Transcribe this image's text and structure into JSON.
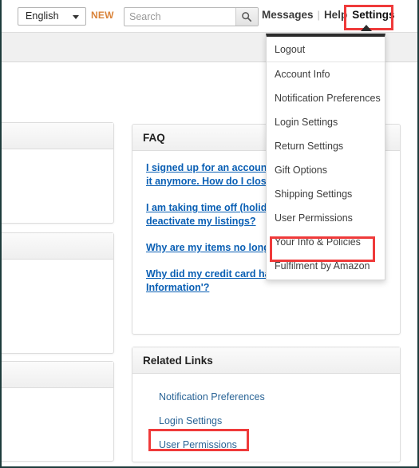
{
  "topbar": {
    "language": {
      "selected": "English",
      "caret_icon": "chevron-down-icon"
    },
    "new_badge": "NEW",
    "search": {
      "value": "",
      "placeholder": "Search",
      "button_icon": "search-icon"
    },
    "nav": {
      "messages": "Messages",
      "separator": "|",
      "help": "Help",
      "settings": "Settings"
    }
  },
  "settings_menu": {
    "items": [
      {
        "label": "Logout"
      },
      {
        "label": "Account Info"
      },
      {
        "label": "Notification Preferences"
      },
      {
        "label": "Login Settings"
      },
      {
        "label": "Return Settings"
      },
      {
        "label": "Gift Options"
      },
      {
        "label": "Shipping Settings"
      },
      {
        "label": "User Permissions"
      },
      {
        "label": "Your Info & Policies"
      },
      {
        "label": "Fulfilment by Amazon"
      }
    ]
  },
  "faq": {
    "title": "FAQ",
    "links": [
      {
        "line1": "I signed up for an account ",
        "line2": "it anymore. How do I close"
      },
      {
        "line1": "I am taking time off (holida",
        "line2": "deactivate my listings?"
      },
      {
        "line1": "Why are my items no longe",
        "line2": ""
      },
      {
        "line1": "Why did my credit card hav",
        "line2": "Information'?"
      }
    ]
  },
  "related_links": {
    "title": "Related Links",
    "links": [
      {
        "label": "Notification Preferences"
      },
      {
        "label": "Login Settings"
      },
      {
        "label": "User Permissions"
      }
    ]
  },
  "left_panels": [
    {
      "title": ""
    },
    {
      "title": ""
    },
    {
      "title": ""
    }
  ],
  "highlights": {
    "color": "#ef3a3a",
    "targets": [
      "Settings",
      "User Permissions",
      "User Permissions"
    ]
  }
}
